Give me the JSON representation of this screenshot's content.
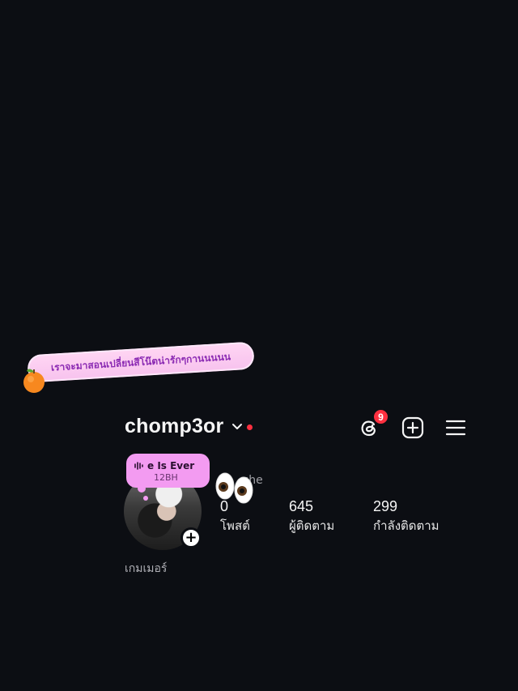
{
  "sticker": {
    "text": "เราจะมาสอนเปลี่ยนสีโน๊ตน่ารักๆกานนนนน"
  },
  "header": {
    "username": "chomp3or",
    "notification_count": "9"
  },
  "note": {
    "title": "e Is Ever",
    "subtitle": "12BH"
  },
  "profile": {
    "pronouns": "she",
    "bio": "เกมเมอร์"
  },
  "stats": [
    {
      "value": "0",
      "label": "โพสต์"
    },
    {
      "value": "645",
      "label": "ผู้ติดตาม"
    },
    {
      "value": "299",
      "label": "กำลังติดตาม"
    }
  ],
  "colors": {
    "background": "#0c0e13",
    "accent_red": "#ff3040",
    "note_pink": "#f39bf1",
    "sticker_pink": "#f7c2ee",
    "sticker_text": "#8b2ab3"
  },
  "icons": [
    "orange-emoji-icon",
    "chevron-down-icon",
    "threads-icon",
    "add-post-icon",
    "menu-icon",
    "sound-wave-icon",
    "eyes-emoji-icon",
    "plus-icon"
  ]
}
